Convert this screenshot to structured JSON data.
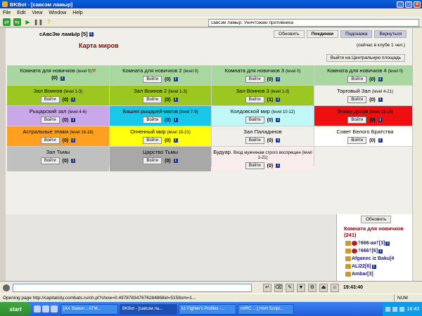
{
  "window": {
    "title": "BKBot - [савсэм ламыр]"
  },
  "menu": [
    "File",
    "Edit",
    "View",
    "Window",
    "Help"
  ],
  "toolbar": {
    "status": "савсэм ламыр: Уничтожаю противника"
  },
  "header": {
    "player": "сАвсЭм ламЫр",
    "player_level": "[5]",
    "nav": [
      "Обновить",
      "Поединки",
      "Подсказка",
      "Вернуться"
    ]
  },
  "map": {
    "title": "Карта миров",
    "club_count": "(сейчас в клубе 1 чел.)",
    "exit_label": "Выйти на Центральную площадь",
    "enter_label": "Войти",
    "rooms": [
      {
        "name": "Комната для новичков",
        "level": "(level 0)",
        "count": "(0)",
        "color": "#a8d8a0",
        "button": false,
        "axe": true
      },
      {
        "name": "Комната для новичков 2",
        "level": "(level 0)",
        "count": "(0)",
        "color": "#a8d8a0",
        "button": true
      },
      {
        "name": "Комната для новичков 3",
        "level": "(level 0)",
        "count": "(0)",
        "color": "#a8d8a0",
        "button": true
      },
      {
        "name": "Комната для новичков 4",
        "level": "(level 0)",
        "count": "(0)",
        "color": "#a8d8a0",
        "button": true
      },
      {
        "name": "Зал Воинов",
        "level": "(level 1-3)",
        "count": "(0)",
        "color": "#9cc720",
        "button": true
      },
      {
        "name": "Зал Воинов 2",
        "level": "(level 1-3)",
        "count": "(0)",
        "color": "#9cc720",
        "button": true
      },
      {
        "name": "Зал Воинов 3",
        "level": "(level 1-3)",
        "count": "(1)",
        "color": "#9cc720",
        "button": true
      },
      {
        "name": "Торговый Зал",
        "level": "(level 4-21)",
        "count": "(0)",
        "color": "#f0efe9",
        "button": true
      },
      {
        "name": "Рыцарский зал",
        "level": "(level 4-6)",
        "count": "(0)",
        "color": "#c8a8e8",
        "button": true
      },
      {
        "name": "Башня рыцарей-магов",
        "level": "(level 7-9)",
        "count": "(0)",
        "color": "#18c8e8",
        "button": true
      },
      {
        "name": "Колдовской мир",
        "level": "(level 10-12)",
        "count": "(0)",
        "color": "#c0f8f8",
        "button": true
      },
      {
        "name": "Этажи духов",
        "level": "(level 13-15)",
        "count": "(0)",
        "color": "#ee1010",
        "button": true
      },
      {
        "name": "Астральные этажи",
        "level": "(level 16-18)",
        "count": "(0)",
        "color": "#ffa020",
        "button": true
      },
      {
        "name": "Огненный мир",
        "level": "(level 19-21)",
        "count": "(0)",
        "color": "#ffff10",
        "button": true
      },
      {
        "name": "Зал Паладинов",
        "level": "",
        "count": "(0)",
        "color": "#f0efe9",
        "button": true
      },
      {
        "name": "Совет Белого Братства",
        "level": "",
        "count": "(0)",
        "color": "#ffffff",
        "button": true
      },
      {
        "name": "Зал Тьмы",
        "level": "",
        "count": "(0)",
        "color": "#c0c0c0",
        "button": true
      },
      {
        "name": "Царство Тьмы",
        "level": "",
        "count": "(0)",
        "color": "#a8a8a8",
        "button": true
      },
      {
        "name": "Будуар.",
        "level": "Вход мужчинам строго воспрещен (level 1-21)",
        "count": "(0)",
        "color": "#f8ecec",
        "button": true
      },
      {
        "name": "",
        "level": "",
        "count": "",
        "color": "#f0efe9",
        "button": false,
        "empty": true
      }
    ]
  },
  "chat": {
    "refresh_label": "Обновить",
    "room": "Комната для новичков (241)",
    "players": [
      "†666-ая†[3]",
      "†666†[6]",
      "Afganec iz Baku[4",
      "ALI22[6]",
      "Ambar[3]"
    ]
  },
  "inputbar": {
    "time": "19:43:40"
  },
  "statusbar": {
    "text": "Opening page http://capitalcity.combats.ru/ch.pl?show=0.497878347676284868id=5158om=1...",
    "num": "NUM"
  },
  "taskbar": {
    "start": "start",
    "tasks": [
      "[AX Station :: ATM...",
      "BKBot - [савсэм ла...",
      "k1 Fighter's Profiles -...",
      "mIRC ...:[ HnH Script..."
    ],
    "clock": "18:43"
  }
}
